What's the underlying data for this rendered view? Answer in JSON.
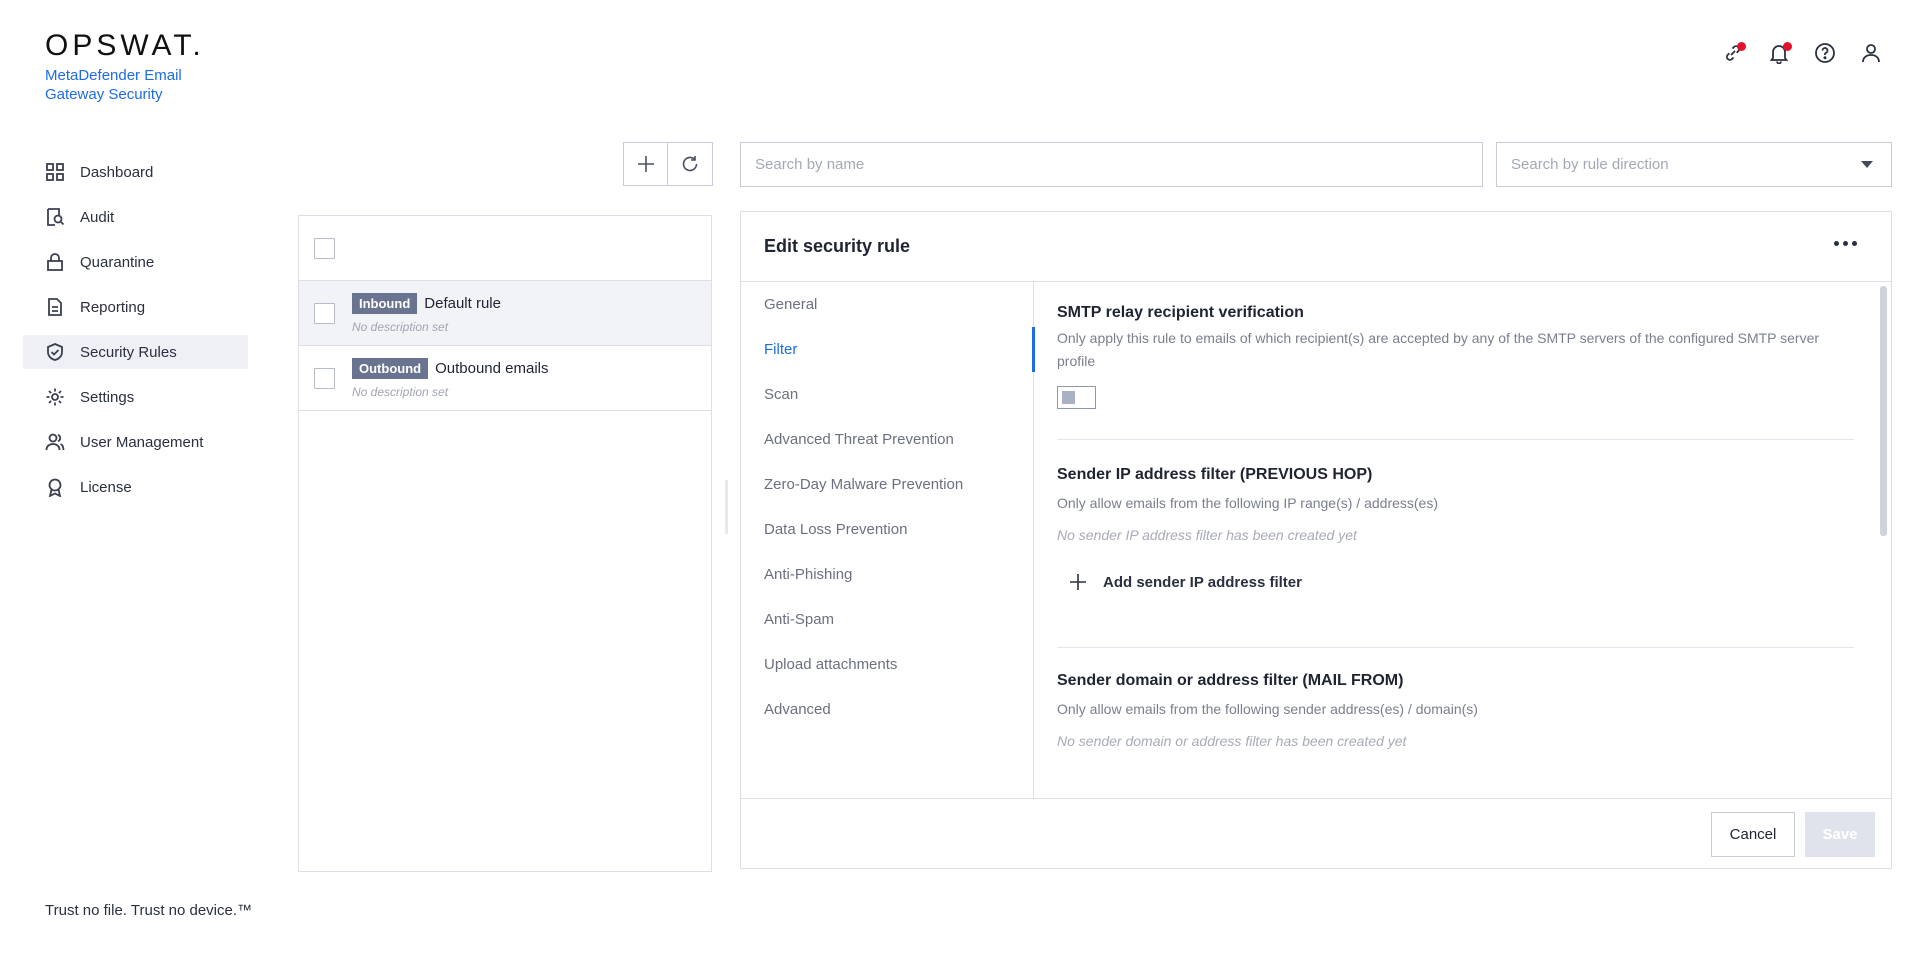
{
  "brand": {
    "logo_text": "OPSWAT.",
    "product_name": "MetaDefender Email Gateway Security",
    "tagline": "Trust no file. Trust no device.™"
  },
  "sidebar": {
    "items": [
      {
        "label": "Dashboard",
        "icon": "dashboard-icon",
        "active": false
      },
      {
        "label": "Audit",
        "icon": "audit-icon",
        "active": false
      },
      {
        "label": "Quarantine",
        "icon": "lock-icon",
        "active": false
      },
      {
        "label": "Reporting",
        "icon": "document-icon",
        "active": false
      },
      {
        "label": "Security Rules",
        "icon": "shield-check-icon",
        "active": true
      },
      {
        "label": "Settings",
        "icon": "gear-icon",
        "active": false
      },
      {
        "label": "User Management",
        "icon": "users-icon",
        "active": false
      },
      {
        "label": "License",
        "icon": "badge-icon",
        "active": false
      }
    ]
  },
  "header_icons": [
    {
      "icon": "link-icon",
      "notification": true
    },
    {
      "icon": "bell-icon",
      "notification": true
    },
    {
      "icon": "help-icon",
      "notification": false
    },
    {
      "icon": "user-icon",
      "notification": false
    }
  ],
  "colors": {
    "accent": "#1d6ce5",
    "notification_dot": "#e5102a",
    "badge_bg": "#6a7491"
  },
  "search": {
    "name_placeholder": "Search by name",
    "direction_placeholder": "Search by rule direction"
  },
  "rules": [
    {
      "direction": "Inbound",
      "name": "Default rule",
      "description": "No description set",
      "selected": true
    },
    {
      "direction": "Outbound",
      "name": "Outbound emails",
      "description": "No description set",
      "selected": false
    }
  ],
  "editor": {
    "title": "Edit security rule",
    "tabs": [
      {
        "label": "General",
        "active": false
      },
      {
        "label": "Filter",
        "active": true
      },
      {
        "label": "Scan",
        "active": false
      },
      {
        "label": "Advanced Threat Prevention",
        "active": false
      },
      {
        "label": "Zero-Day Malware Prevention",
        "active": false
      },
      {
        "label": "Data Loss Prevention",
        "active": false
      },
      {
        "label": "Anti-Phishing",
        "active": false
      },
      {
        "label": "Anti-Spam",
        "active": false
      },
      {
        "label": "Upload attachments",
        "active": false
      },
      {
        "label": "Advanced",
        "active": false
      }
    ],
    "sections": {
      "smtp": {
        "title": "SMTP relay recipient verification",
        "description": "Only apply this rule to emails of which recipient(s) are accepted by any of the SMTP servers of the configured SMTP server profile",
        "enabled": false
      },
      "sender_ip": {
        "title": "Sender IP address filter (PREVIOUS HOP)",
        "description": "Only allow emails from the following IP range(s) / address(es)",
        "empty": "No sender IP address filter has been created yet",
        "add_label": "Add sender IP address filter"
      },
      "sender_domain": {
        "title": "Sender domain or address filter (MAIL FROM)",
        "description": "Only allow emails from the following sender address(es) / domain(s)",
        "empty": "No sender domain or address filter has been created yet"
      }
    },
    "cancel_label": "Cancel",
    "save_label": "Save"
  }
}
